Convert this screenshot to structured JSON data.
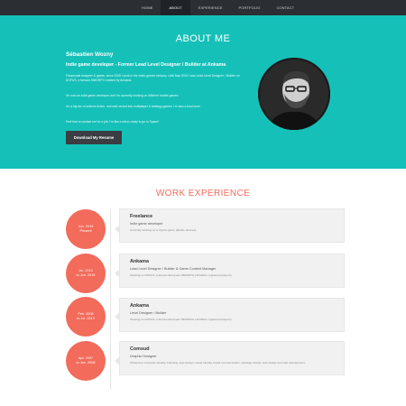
{
  "nav": {
    "items": [
      {
        "label": "HOME",
        "active": false
      },
      {
        "label": "ABOUT",
        "active": true
      },
      {
        "label": "EXPERIENCE",
        "active": false
      },
      {
        "label": "PORTFOLIO",
        "active": false
      },
      {
        "label": "CONTACT",
        "active": false
      }
    ]
  },
  "about": {
    "title": "ABOUT ME",
    "name": "Sébastien Wozny",
    "role": "Indie game developer - Former Lead Level Designer / Builder at Ankama",
    "p1": "Passionate designer & gamer, since 2008 I work in the video games industry. Until May 2015 I was Lead Level Designer / Builder on DOFUS, a famous MMORPG created by Ankama.",
    "p2": "I'm now an indie game developer and I'm currently working on different mobile games.",
    "p3": "I'm a big fan of science fiction, and well versed into multiplayer & strategy games. I'm also a food lover.",
    "p4": "Feel free to contact me for a job. I'm like a robot, ready to go to Space!",
    "button_label": "Download My Resume"
  },
  "work": {
    "title": "WORK EXPERIENCE",
    "entries": [
      {
        "date_line1": "Jun. 2015",
        "date_line2": "Present",
        "company": "Freelance",
        "role": "Indie game developer",
        "desc": "Currently working on a rhythm game (Mobile devices)."
      },
      {
        "date_line1": "Jul. 2013",
        "date_line2": "to Jun. 2015",
        "company": "Ankama",
        "role": "Lead Level Designer / Builder & Game Content Manager",
        "desc": "Working on DOFUS, a famous European MMORPG (40 Million registered players)."
      },
      {
        "date_line1": "Feb. 2008",
        "date_line2": "to Jul. 2013",
        "company": "Ankama",
        "role": "Level Designer / Builder",
        "desc": "Working on DOFUS, a famous European MMORPG (40 Million registered players)."
      },
      {
        "date_line1": "Apr. 2007",
        "date_line2": "to Jan. 2008",
        "company": "Comsud",
        "role": "Graphic Designer",
        "desc": "Worked on corporate identity, branding, logo design, visual identity, brand communication, package design, web design and web development."
      }
    ]
  },
  "colors": {
    "nav_bg": "#2b2e33",
    "accent_teal": "#15c0b8",
    "accent_coral": "#f26b5b",
    "button_bg": "#3a3d42"
  },
  "icons": {
    "avatar": "profile-photo"
  }
}
